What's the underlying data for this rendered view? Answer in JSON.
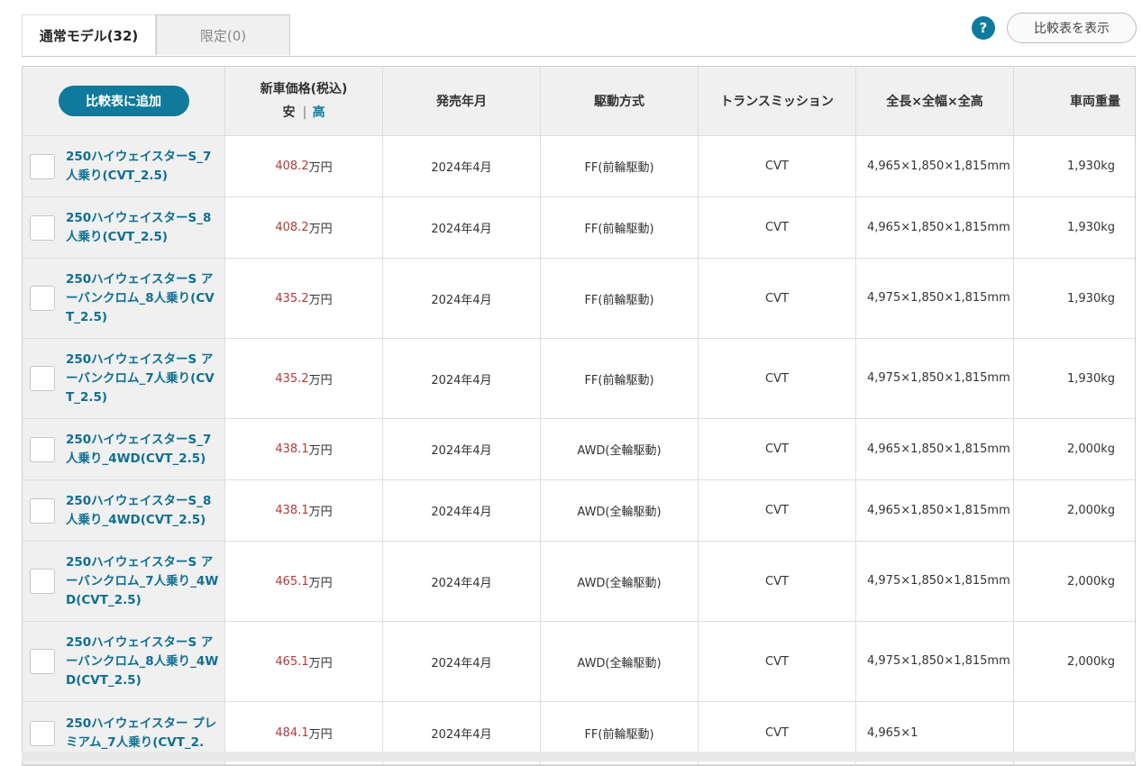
{
  "tabs": {
    "regular": "通常モデル(32)",
    "limited": "限定(0)"
  },
  "help_icon": "?",
  "compare_table_button": "比較表を表示",
  "header": {
    "add_button": "比較表に追加",
    "price": "新車価格(税込)",
    "sort_low": "安",
    "sort_sep": "|",
    "sort_high": "高",
    "release": "発売年月",
    "drive": "駆動方式",
    "transmission": "トランスミッション",
    "dimensions": "全長×全幅×全高",
    "weight": "車両重量"
  },
  "rows": [
    {
      "name": "250ハイウェイスターS_7人乗り(CVT_2.5)",
      "price": "408.2",
      "unit": "万円",
      "release": "2024年4月",
      "drive": "FF(前輪駆動)",
      "trans": "CVT",
      "dims": "4,965×1,850×1,815mm",
      "weight": "1,930kg"
    },
    {
      "name": "250ハイウェイスターS_8人乗り(CVT_2.5)",
      "price": "408.2",
      "unit": "万円",
      "release": "2024年4月",
      "drive": "FF(前輪駆動)",
      "trans": "CVT",
      "dims": "4,965×1,850×1,815mm",
      "weight": "1,930kg"
    },
    {
      "name": "250ハイウェイスターS アーバンクロム_8人乗り(CVT_2.5)",
      "price": "435.2",
      "unit": "万円",
      "release": "2024年4月",
      "drive": "FF(前輪駆動)",
      "trans": "CVT",
      "dims": "4,975×1,850×1,815mm",
      "weight": "1,930kg"
    },
    {
      "name": "250ハイウェイスターS アーバンクロム_7人乗り(CVT_2.5)",
      "price": "435.2",
      "unit": "万円",
      "release": "2024年4月",
      "drive": "FF(前輪駆動)",
      "trans": "CVT",
      "dims": "4,975×1,850×1,815mm",
      "weight": "1,930kg"
    },
    {
      "name": "250ハイウェイスターS_7人乗り_4WD(CVT_2.5)",
      "price": "438.1",
      "unit": "万円",
      "release": "2024年4月",
      "drive": "AWD(全輪駆動)",
      "trans": "CVT",
      "dims": "4,965×1,850×1,815mm",
      "weight": "2,000kg"
    },
    {
      "name": "250ハイウェイスターS_8人乗り_4WD(CVT_2.5)",
      "price": "438.1",
      "unit": "万円",
      "release": "2024年4月",
      "drive": "AWD(全輪駆動)",
      "trans": "CVT",
      "dims": "4,965×1,850×1,815mm",
      "weight": "2,000kg"
    },
    {
      "name": "250ハイウェイスターS アーバンクロム_7人乗り_4WD(CVT_2.5)",
      "price": "465.1",
      "unit": "万円",
      "release": "2024年4月",
      "drive": "AWD(全輪駆動)",
      "trans": "CVT",
      "dims": "4,975×1,850×1,815mm",
      "weight": "2,000kg"
    },
    {
      "name": "250ハイウェイスターS アーバンクロム_8人乗り_4WD(CVT_2.5)",
      "price": "465.1",
      "unit": "万円",
      "release": "2024年4月",
      "drive": "AWD(全輪駆動)",
      "trans": "CVT",
      "dims": "4,975×1,850×1,815mm",
      "weight": "2,000kg"
    },
    {
      "name": "250ハイウェイスター プレミアム_7人乗り(CVT_2.",
      "price": "484.1",
      "unit": "万円",
      "release": "2024年4月",
      "drive": "FF(前輪駆動)",
      "trans": "CVT",
      "dims": "4,965×1",
      "weight": ""
    }
  ],
  "colors": {
    "accent": "#0f7a9c",
    "price": "#b23a3a",
    "header_bg": "#f0f0f0"
  }
}
